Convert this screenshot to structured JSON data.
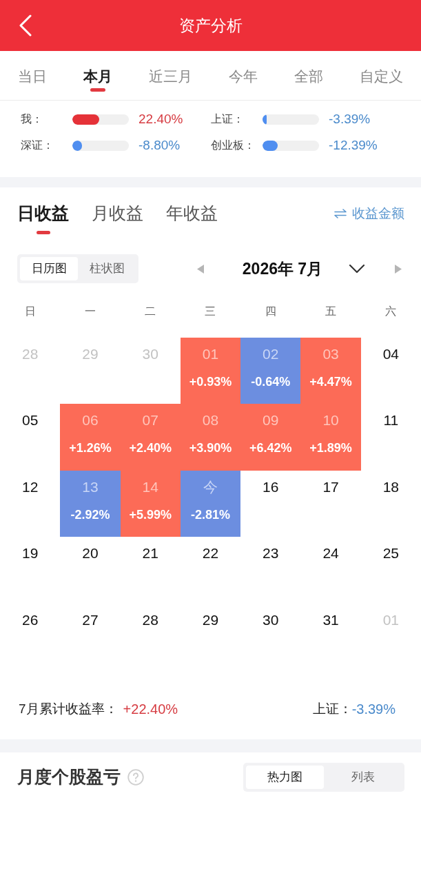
{
  "header": {
    "title": "资产分析"
  },
  "period_tabs": [
    {
      "label": "当日",
      "selected": false
    },
    {
      "label": "本月",
      "selected": true
    },
    {
      "label": "近三月",
      "selected": false
    },
    {
      "label": "今年",
      "selected": false
    },
    {
      "label": "全部",
      "selected": false
    },
    {
      "label": "自定义",
      "selected": false
    }
  ],
  "comparisons": [
    {
      "label": "我：",
      "level": 0.48,
      "value": "22.40%",
      "kind": "gain"
    },
    {
      "label": "上证：",
      "level": 0.07,
      "value": "-3.39%",
      "kind": "loss"
    },
    {
      "label": "深证：",
      "level": 0.17,
      "value": "-8.80%",
      "kind": "loss"
    },
    {
      "label": "创业板：",
      "level": 0.27,
      "value": "-12.39%",
      "kind": "loss"
    }
  ],
  "return_tabs": [
    {
      "label": "日收益",
      "selected": true
    },
    {
      "label": "月收益",
      "selected": false
    },
    {
      "label": "年收益",
      "selected": false
    }
  ],
  "amount_switch": {
    "label": "收益金额"
  },
  "view_toggle": [
    {
      "label": "日历图",
      "selected": true
    },
    {
      "label": "柱状图",
      "selected": false
    }
  ],
  "month_nav": {
    "title": "2026年 7月"
  },
  "weekdays": [
    "日",
    "一",
    "二",
    "三",
    "四",
    "五",
    "六"
  ],
  "weeks": [
    [
      {
        "day": "28",
        "kind": "outside"
      },
      {
        "day": "29",
        "kind": "outside"
      },
      {
        "day": "30",
        "kind": "outside"
      },
      {
        "day": "01",
        "kind": "gain",
        "change": "+0.93%"
      },
      {
        "day": "02",
        "kind": "loss",
        "change": "-0.64%"
      },
      {
        "day": "03",
        "kind": "gain",
        "change": "+4.47%"
      },
      {
        "day": "04",
        "kind": "plain"
      }
    ],
    [
      {
        "day": "05",
        "kind": "plain"
      },
      {
        "day": "06",
        "kind": "gain",
        "change": "+1.26%"
      },
      {
        "day": "07",
        "kind": "gain",
        "change": "+2.40%"
      },
      {
        "day": "08",
        "kind": "gain",
        "change": "+3.90%"
      },
      {
        "day": "09",
        "kind": "gain",
        "change": "+6.42%"
      },
      {
        "day": "10",
        "kind": "gain",
        "change": "+1.89%"
      },
      {
        "day": "11",
        "kind": "plain"
      }
    ],
    [
      {
        "day": "12",
        "kind": "plain"
      },
      {
        "day": "13",
        "kind": "loss",
        "change": "-2.92%"
      },
      {
        "day": "14",
        "kind": "gain",
        "change": "+5.99%"
      },
      {
        "day": "今",
        "kind": "loss",
        "change": "-2.81%"
      },
      {
        "day": "16",
        "kind": "plain"
      },
      {
        "day": "17",
        "kind": "plain"
      },
      {
        "day": "18",
        "kind": "plain"
      }
    ],
    [
      {
        "day": "19",
        "kind": "plain"
      },
      {
        "day": "20",
        "kind": "plain"
      },
      {
        "day": "21",
        "kind": "plain"
      },
      {
        "day": "22",
        "kind": "plain"
      },
      {
        "day": "23",
        "kind": "plain"
      },
      {
        "day": "24",
        "kind": "plain"
      },
      {
        "day": "25",
        "kind": "plain"
      }
    ],
    [
      {
        "day": "26",
        "kind": "plain"
      },
      {
        "day": "27",
        "kind": "plain"
      },
      {
        "day": "28",
        "kind": "plain"
      },
      {
        "day": "29",
        "kind": "plain"
      },
      {
        "day": "30",
        "kind": "plain"
      },
      {
        "day": "31",
        "kind": "plain"
      },
      {
        "day": "01",
        "kind": "outside"
      }
    ]
  ],
  "summary": {
    "label": "7月累计收益率：",
    "value": "+22.40%",
    "benchmark_label": "上证：",
    "benchmark_value": "-3.39%"
  },
  "stock_section": {
    "title": "月度个股盈亏",
    "toggle": [
      {
        "label": "热力图",
        "selected": true
      },
      {
        "label": "列表",
        "selected": false
      }
    ]
  }
}
